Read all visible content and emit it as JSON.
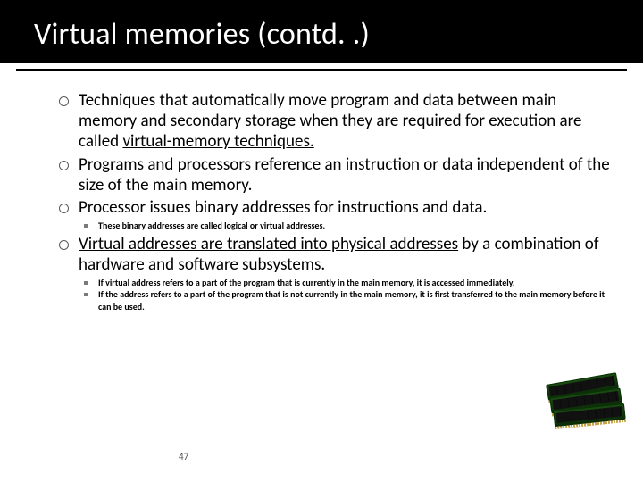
{
  "title": "Virtual memories (contd. .)",
  "bullets": {
    "b1a": "Techniques that automatically move program and data between main memory and secondary storage when they are required for execution are called ",
    "b1u": "virtual-memory techniques.",
    "b2": "Programs and processors reference an instruction or data independent of the size of the main memory.",
    "b3": "Processor issues binary addresses for instructions and data.",
    "s1": "These binary addresses are called logical or virtual addresses.",
    "b4u": "Virtual addresses are translated into physical addresses",
    "b4b": " by a combination of hardware and software subsystems.",
    "s2": "If virtual address refers to a part of the program that is currently in the main memory, it is accessed immediately.",
    "s3": "If the address refers to a part of the program that is not currently in the main memory, it is first transferred to the main memory before it can be used."
  },
  "page": "47"
}
